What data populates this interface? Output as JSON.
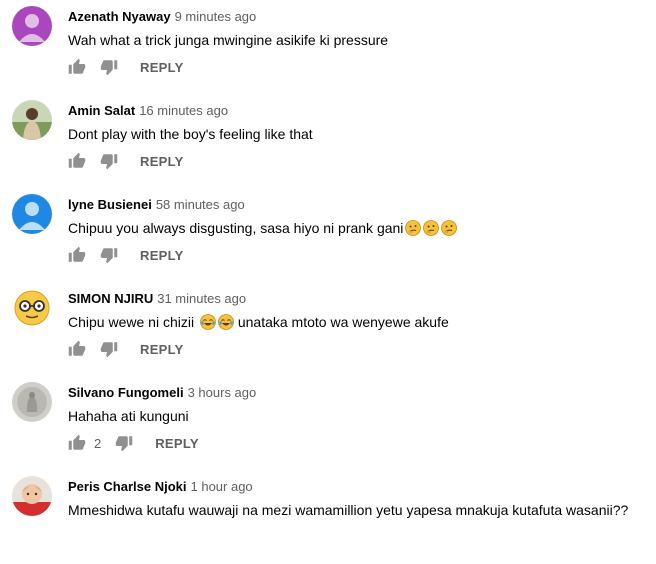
{
  "comments": [
    {
      "author": "Azenath Nyaway",
      "time": "9 minutes ago",
      "text": "Wah what a trick junga mwingine asikife ki pressure",
      "likes": "",
      "reply": "REPLY"
    },
    {
      "author": "Amin Salat",
      "time": "16 minutes ago",
      "text": "Dont play with the boy's feeling like that",
      "likes": "",
      "reply": "REPLY"
    },
    {
      "author": "lyne Busienei",
      "time": "58 minutes ago",
      "text": "Chipuu you always disgusting, sasa hiyo ni prank gani",
      "likes": "",
      "reply": "REPLY"
    },
    {
      "author": "SIMON NJIRU",
      "time": "31 minutes ago",
      "text": "Chipu wewe ni chizii",
      "text_after": "unataka mtoto wa wenyewe akufe",
      "likes": "",
      "reply": "REPLY"
    },
    {
      "author": "Silvano Fungomeli",
      "time": "3 hours ago",
      "text": "Hahaha ati kunguni",
      "likes": "2",
      "reply": "REPLY"
    },
    {
      "author": "Peris Charlse Njoki",
      "time": "1 hour ago",
      "text": "Mmeshidwa kutafu wauwaji na mezi wamamillion  yetu yapesa mnakuja kutafuta wasanii??",
      "likes": "",
      "reply": "REPLY"
    }
  ],
  "icons": {
    "like": "thumbs-up-icon",
    "dislike": "thumbs-down-icon",
    "thinking": "thinking-face-emoji",
    "laughing": "tears-of-joy-emoji"
  },
  "colors": {
    "meta": "#606060",
    "text": "#030303"
  }
}
